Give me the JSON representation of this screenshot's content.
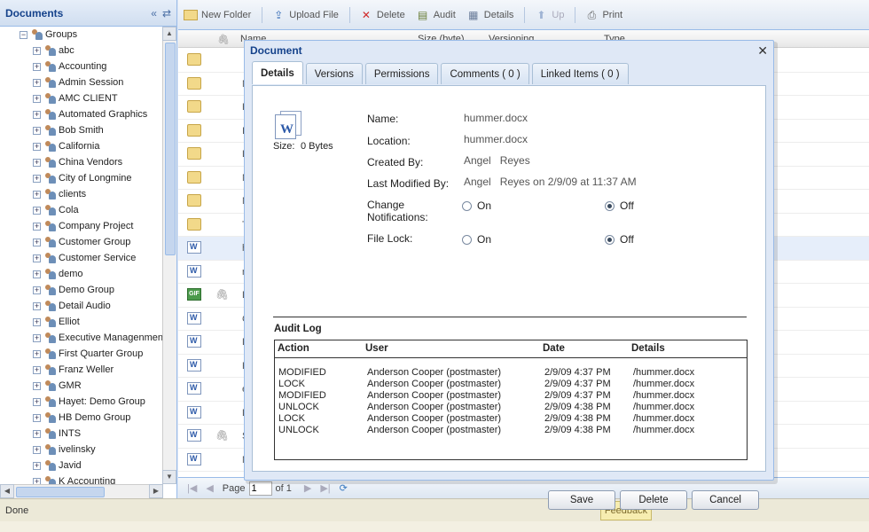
{
  "tree": {
    "title": "Documents",
    "root_label": "Groups",
    "items": [
      "abc",
      "Accounting",
      "Admin Session",
      "AMC CLIENT",
      "Automated Graphics",
      "Bob Smith",
      "California",
      "China Vendors",
      "City of Longmine",
      "clients",
      "Cola",
      "Company Project",
      "Customer Group",
      "Customer Service",
      "demo",
      "Demo Group",
      "Detail Audio",
      "Elliot",
      "Executive Managenment",
      "First Quarter Group",
      "Franz Weller",
      "GMR",
      "Hayet: Demo Group",
      "HB Demo Group",
      "INTS",
      "ivelinsky",
      "Javid",
      "K Accounting"
    ]
  },
  "toolbar": {
    "new_folder": "New Folder",
    "upload_file": "Upload File",
    "delete": "Delete",
    "audit": "Audit",
    "details": "Details",
    "up": "Up",
    "print": "Print"
  },
  "grid": {
    "columns": [
      "Name",
      "Size (byte)",
      "Versioning",
      "Type"
    ],
    "row_stubs": [
      "",
      "N",
      "H",
      "I",
      "L",
      "N",
      "N",
      "T",
      "h",
      "n",
      "D",
      "C",
      "D",
      "H",
      "e",
      "D",
      "S",
      "N"
    ]
  },
  "pager": {
    "page_label": "Page",
    "page_value": "1",
    "of_label": "of 1"
  },
  "status": {
    "text": "Done",
    "feedback": "Feedback"
  },
  "dialog": {
    "title": "Document",
    "tabs": [
      "Details",
      "Versions",
      "Permissions",
      "Comments ( 0 )",
      "Linked Items ( 0 )"
    ],
    "size_label": "Size:",
    "size_value": "0 Bytes",
    "props": {
      "name_label": "Name:",
      "name_value": "hummer.docx",
      "location_label": "Location:",
      "location_value": "hummer.docx",
      "created_label": "Created By:",
      "created_value": "Angel   Reyes",
      "modified_label": "Last Modified By:",
      "modified_value": "Angel   Reyes on 2/9/09 at 11:37 AM",
      "notif_label_1": "Change",
      "notif_label_2": "Notifications:",
      "lock_label": "File Lock:",
      "on": "On",
      "off": "Off",
      "notifications_selected": "Off",
      "file_lock_selected": "Off"
    },
    "audit": {
      "title": "Audit Log",
      "headers": [
        "Action",
        "User",
        "Date",
        "Details"
      ],
      "rows": [
        [
          "MODIFIED",
          "Anderson Cooper (postmaster)",
          "2/9/09 4:37 PM",
          "/hummer.docx"
        ],
        [
          "LOCK",
          "Anderson Cooper (postmaster)",
          "2/9/09 4:37 PM",
          "/hummer.docx"
        ],
        [
          "MODIFIED",
          "Anderson Cooper (postmaster)",
          "2/9/09 4:37 PM",
          "/hummer.docx"
        ],
        [
          "UNLOCK",
          "Anderson Cooper (postmaster)",
          "2/9/09 4:38 PM",
          "/hummer.docx"
        ],
        [
          "LOCK",
          "Anderson Cooper (postmaster)",
          "2/9/09 4:38 PM",
          "/hummer.docx"
        ],
        [
          "UNLOCK",
          "Anderson Cooper (postmaster)",
          "2/9/09 4:38 PM",
          "/hummer.docx"
        ]
      ]
    },
    "buttons": {
      "save": "Save",
      "delete": "Delete",
      "cancel": "Cancel"
    }
  },
  "colors": {
    "accent": "#15428b",
    "panel_border": "#99bbe8",
    "panel_bg": "#dfe8f6"
  }
}
